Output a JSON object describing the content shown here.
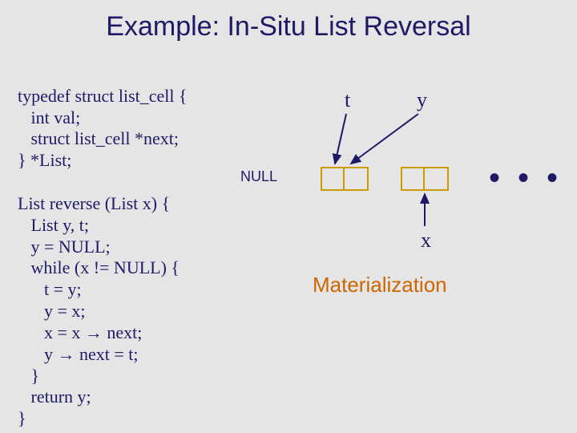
{
  "title": "Example: In-Situ List Reversal",
  "typedef": {
    "line1": "typedef struct list_cell {",
    "line2": "   int val;",
    "line3": "   struct list_cell *next;",
    "line4": "} *List;"
  },
  "function": {
    "line1": "List reverse (List x) {",
    "line2": "   List y, t;",
    "line3": "   y = NULL;",
    "line4": "   while (x != NULL) {",
    "line5": "      t = y;",
    "line6": "      y = x;",
    "line7": "      x = x → next;",
    "line8": "      y → next = t;",
    "line9": "   }",
    "line10": "   return y;",
    "line11": "}"
  },
  "diagram": {
    "pointer_t": "t",
    "pointer_y": "y",
    "pointer_x": "x",
    "null_label": "NULL",
    "dots": "• • •",
    "caption": "Materialization"
  }
}
